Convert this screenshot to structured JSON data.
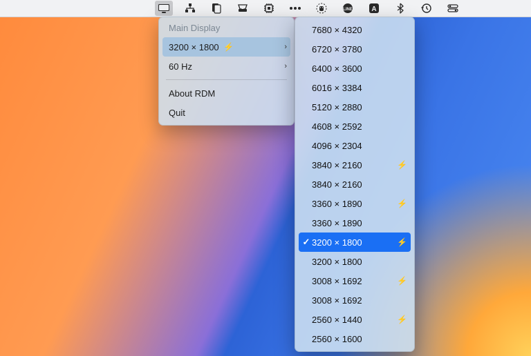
{
  "menubar": {
    "icons": [
      {
        "name": "display-icon",
        "active": true
      },
      {
        "name": "network-icon"
      },
      {
        "name": "clipboard-icon"
      },
      {
        "name": "inbox-icon"
      },
      {
        "name": "cpu-icon"
      },
      {
        "name": "password-dots-icon"
      },
      {
        "name": "android-icon"
      },
      {
        "name": "line-app-icon"
      },
      {
        "name": "font-a-icon"
      },
      {
        "name": "bluetooth-icon"
      },
      {
        "name": "timemachine-icon"
      },
      {
        "name": "control-center-icon"
      }
    ]
  },
  "menu": {
    "header": "Main Display",
    "resolution_row": {
      "label": "3200 × 1800",
      "bolt": "⚡"
    },
    "refresh_row": {
      "label": "60 Hz"
    },
    "about": "About RDM",
    "quit": "Quit"
  },
  "submenu": {
    "items": [
      {
        "label": "7680 × 4320",
        "bolt": false,
        "selected": false
      },
      {
        "label": "6720 × 3780",
        "bolt": false,
        "selected": false
      },
      {
        "label": "6400 × 3600",
        "bolt": false,
        "selected": false
      },
      {
        "label": "6016 × 3384",
        "bolt": false,
        "selected": false
      },
      {
        "label": "5120 × 2880",
        "bolt": false,
        "selected": false
      },
      {
        "label": "4608 × 2592",
        "bolt": false,
        "selected": false
      },
      {
        "label": "4096 × 2304",
        "bolt": false,
        "selected": false
      },
      {
        "label": "3840 × 2160",
        "bolt": true,
        "selected": false
      },
      {
        "label": "3840 × 2160",
        "bolt": false,
        "selected": false
      },
      {
        "label": "3360 × 1890",
        "bolt": true,
        "selected": false
      },
      {
        "label": "3360 × 1890",
        "bolt": false,
        "selected": false
      },
      {
        "label": "3200 × 1800",
        "bolt": true,
        "selected": true
      },
      {
        "label": "3200 × 1800",
        "bolt": false,
        "selected": false
      },
      {
        "label": "3008 × 1692",
        "bolt": true,
        "selected": false
      },
      {
        "label": "3008 × 1692",
        "bolt": false,
        "selected": false
      },
      {
        "label": "2560 × 1440",
        "bolt": true,
        "selected": false
      },
      {
        "label": "2560 × 1600",
        "bolt": false,
        "selected": false
      }
    ]
  },
  "glyphs": {
    "bolt": "⚡",
    "check": "✓",
    "chevron": "›"
  }
}
